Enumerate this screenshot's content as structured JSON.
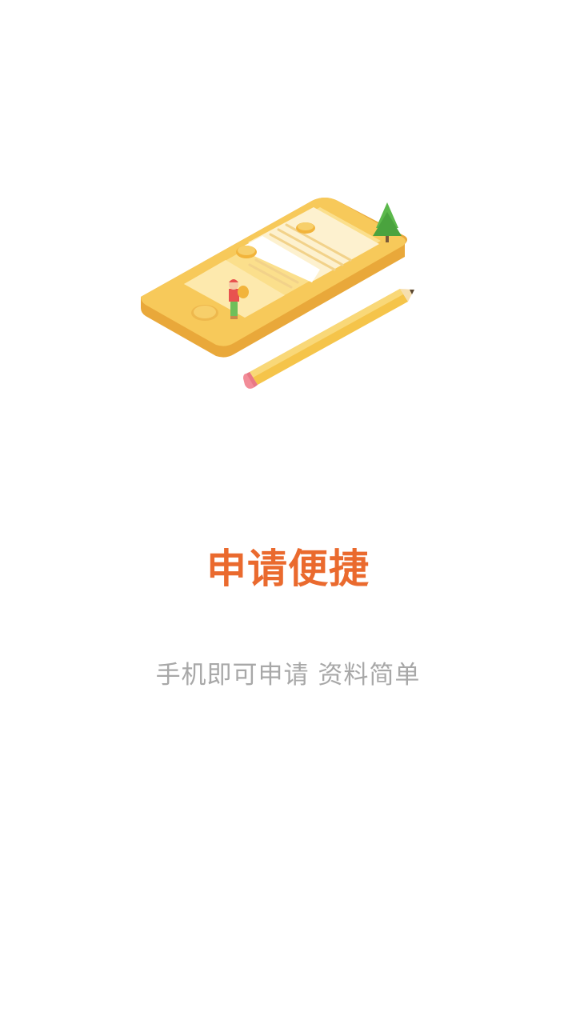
{
  "onboarding": {
    "illustration_icon": "phone-with-pencil-illustration",
    "title": "申请便捷",
    "subtitle": "手机即可申请 资料简单"
  },
  "colors": {
    "title": "#ea6a2e",
    "subtitle": "#a8a8a8",
    "phone_body": "#f7c95a",
    "phone_side": "#e9a83a",
    "paper": "#fdf1cf",
    "tree": "#5bb84b",
    "pencil": "#f5c44a",
    "eraser": "#f28c98"
  }
}
